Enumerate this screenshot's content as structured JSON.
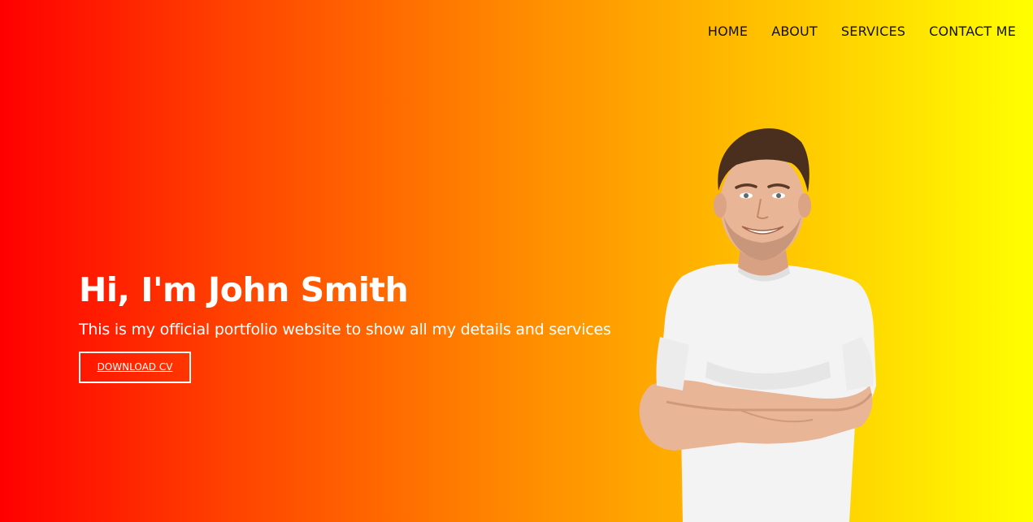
{
  "nav": {
    "items": [
      {
        "label": "HOME"
      },
      {
        "label": "ABOUT"
      },
      {
        "label": "SERVICES"
      },
      {
        "label": "CONTACT ME"
      }
    ]
  },
  "hero": {
    "title": "Hi, I'm John Smith",
    "subtitle": "This is my official portfolio website to show all my details and services",
    "cta_label": "DOWNLOAD CV"
  },
  "colors": {
    "gradient_start": "#ff0000",
    "gradient_end": "#ffff00",
    "text_light": "#ffffff",
    "nav_text": "#111111",
    "shirt": "#f2f2f2",
    "skin": "#e8b596",
    "hair": "#4a2e1e"
  },
  "icons": {
    "profile_photo": "person-portrait-image"
  }
}
